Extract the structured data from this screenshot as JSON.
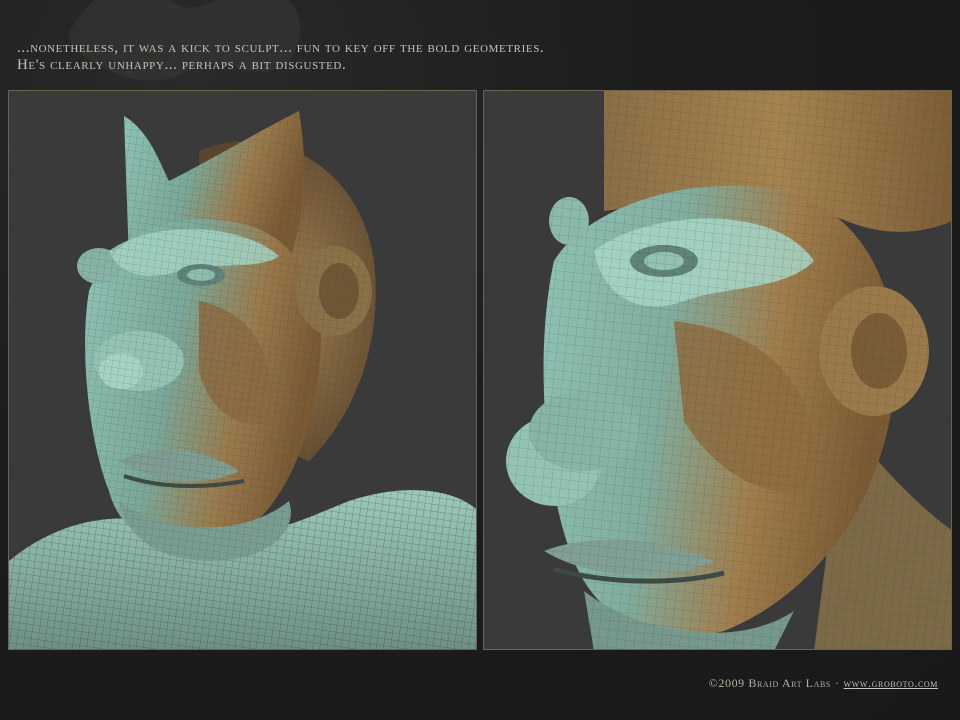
{
  "caption": {
    "line1": "...nonetheless, it was a kick to sculpt... fun to key off the bold geometries.",
    "line2": "He's clearly unhappy... perhaps a bit disgusted."
  },
  "panels": [
    {
      "name": "sculpt-view-three-quarter"
    },
    {
      "name": "sculpt-view-closeup"
    }
  ],
  "footer": {
    "copyright": "©2009 Braid Art Labs",
    "separator": "·",
    "link": "www.groboto.com"
  },
  "colors": {
    "background": "#1d1d1d",
    "panel_bg": "#393939",
    "panel_border": "#6a6450",
    "caption_text": "#c7c2b3",
    "sculpt_teal": "#86b8aa",
    "sculpt_bronze": "#9a7444"
  }
}
